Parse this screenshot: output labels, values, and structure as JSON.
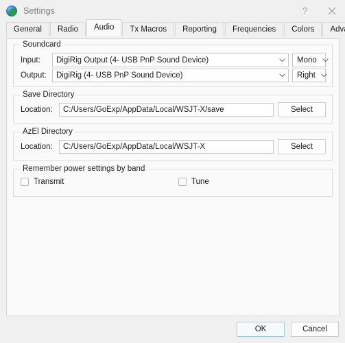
{
  "window": {
    "title": "Settings",
    "icon": "globe-icon",
    "help_label": "?",
    "close_label": "close-icon"
  },
  "tabs": [
    {
      "label": "General",
      "active": false
    },
    {
      "label": "Radio",
      "active": false
    },
    {
      "label": "Audio",
      "active": true
    },
    {
      "label": "Tx Macros",
      "active": false
    },
    {
      "label": "Reporting",
      "active": false
    },
    {
      "label": "Frequencies",
      "active": false
    },
    {
      "label": "Colors",
      "active": false
    },
    {
      "label": "Advanced",
      "active": false
    }
  ],
  "soundcard": {
    "title": "Soundcard",
    "input_label": "Input:",
    "input_value": "DigiRig Output (4- USB PnP Sound Device)",
    "input_channel": "Mono",
    "output_label": "Output:",
    "output_value": "DigiRig (4- USB PnP Sound Device)",
    "output_channel": "Right"
  },
  "save_directory": {
    "title": "Save Directory",
    "location_label": "Location:",
    "location_value": "C:/Users/GoExp/AppData/Local/WSJT-X/save",
    "select_label": "Select"
  },
  "azel_directory": {
    "title": "AzEl Directory",
    "location_label": "Location:",
    "location_value": "C:/Users/GoExp/AppData/Local/WSJT-X",
    "select_label": "Select"
  },
  "power_settings": {
    "title": "Remember power settings by band",
    "transmit_label": "Transmit",
    "transmit_checked": false,
    "tune_label": "Tune",
    "tune_checked": false
  },
  "footer": {
    "ok_label": "OK",
    "cancel_label": "Cancel"
  },
  "colors": {
    "window_bg": "#f0f0f0",
    "panel_bg": "#fafafa",
    "field_bg": "#ffffff",
    "border": "#d4d4d4",
    "text": "#1b1b1b",
    "title_text": "#7b7b7b",
    "default_button_border": "#9ec6e0"
  }
}
